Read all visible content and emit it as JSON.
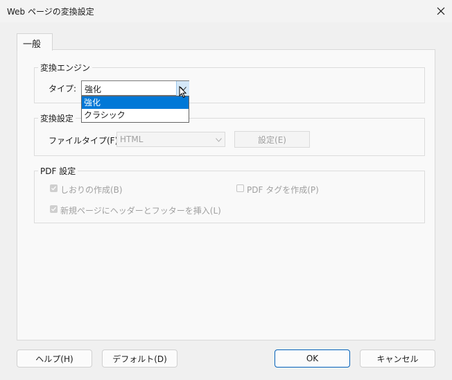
{
  "window": {
    "title": "Web ページの変換設定",
    "close_icon": "close-icon"
  },
  "tabs": [
    {
      "label": "一般",
      "selected": true
    }
  ],
  "conversion_engine": {
    "legend": "変換エンジン",
    "type_label": "タイプ:",
    "type_value": "強化",
    "options": [
      "強化",
      "クラシック"
    ],
    "highlighted_option": "強化"
  },
  "conversion_settings": {
    "legend": "変換設定",
    "file_type_label": "ファイルタイプ(F):",
    "file_type_value": "HTML",
    "settings_button": "設定(E)"
  },
  "pdf_settings": {
    "legend": "PDF 設定",
    "create_bookmarks": {
      "label": "しおりの作成(B)",
      "checked": true,
      "enabled": false
    },
    "create_pdf_tags": {
      "label": "PDF タグを作成(P)",
      "checked": false,
      "enabled": false
    },
    "insert_header_footer": {
      "label": "新規ページにヘッダーとフッターを挿入(L)",
      "checked": true,
      "enabled": false
    }
  },
  "footer": {
    "help": "ヘルプ(H)",
    "default": "デフォルト(D)",
    "ok": "OK",
    "cancel": "キャンセル"
  },
  "colors": {
    "selection": "#0078d7",
    "ok_border": "#005fb8",
    "combo_arrow_bg": "#d4e8f8"
  }
}
